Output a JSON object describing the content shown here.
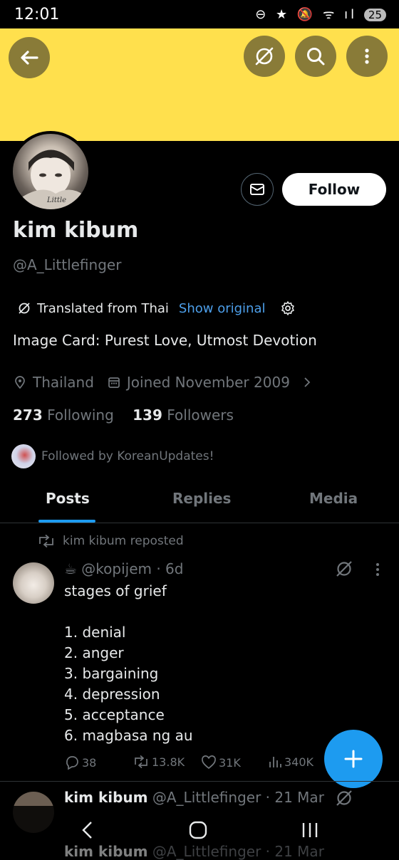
{
  "status_bar": {
    "time": "12:01",
    "icons": "⊖ ★ 🔕 ᯤ ıl",
    "battery": "25"
  },
  "header": {
    "back_icon": "back-arrow-icon",
    "translate_icon": "translate-off-icon",
    "search_icon": "search-icon",
    "more_icon": "more-vertical-icon",
    "banner_color": "#ffe04d"
  },
  "profile": {
    "name": "kim kibum",
    "handle": "@A_Littlefinger",
    "follow_label": "Follow",
    "translated_label": "Translated from Thai",
    "show_original_label": "Show original",
    "bio": "Image Card: Purest Love, Utmost Devotion",
    "location": "Thailand",
    "joined": "Joined November 2009",
    "following_count": "273",
    "following_label": "Following",
    "followers_count": "139",
    "followers_label": "Followers",
    "followed_by": "Followed by KoreanUpdates!"
  },
  "tabs": [
    {
      "label": "Posts",
      "active": true
    },
    {
      "label": "Replies",
      "active": false
    },
    {
      "label": "Media",
      "active": false
    }
  ],
  "post": {
    "repost_label": "kim kibum reposted",
    "author": "☕ @kopijem · 6d",
    "text": "stages of grief\n\n1. denial\n2. anger\n3. bargaining\n4. depression\n5. acceptance\n6. magbasa ng au",
    "replies": "38",
    "reposts": "13.8K",
    "likes": "31K",
    "views": "340K"
  },
  "next_post": {
    "name": "kim kibum",
    "meta": "@A_Littlefinger · 21 Mar"
  },
  "accent_color": "#1d9bf0"
}
